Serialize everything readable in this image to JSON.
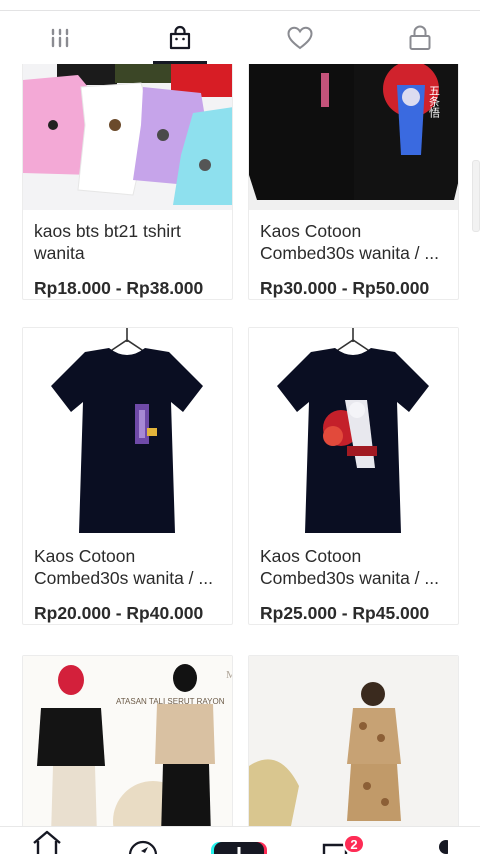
{
  "tabs": [
    {
      "icon": "grid-icon",
      "active": false
    },
    {
      "icon": "shopping-bag-icon",
      "active": true
    },
    {
      "icon": "heart-icon",
      "active": false
    },
    {
      "icon": "lock-icon",
      "active": false
    }
  ],
  "products": [
    {
      "title": "kaos bts bt21 tshirt wanita",
      "price": "Rp18.000 - Rp38.000",
      "image": "pastel-tshirts-photo"
    },
    {
      "title": "Kaos Cotoon Combed30s wanita / ...",
      "price": "Rp30.000 - Rp50.000",
      "image": "black-anime-tshirt-photo"
    },
    {
      "title": "Kaos Cotoon Combed30s wanita / ...",
      "price": "Rp20.000 - Rp40.000",
      "image": "black-tshirt-purple-print-photo"
    },
    {
      "title": "Kaos Cotoon Combed30s wanita / ...",
      "price": "Rp25.000 - Rp45.000",
      "image": "black-tshirt-red-print-photo"
    },
    {
      "title": "",
      "price": "",
      "image": "hijab-models-photo"
    },
    {
      "title": "",
      "price": "",
      "image": "kid-camo-set-photo"
    }
  ],
  "product_photo_text": {
    "banner": "ATASAN TALI SERUT RAYON",
    "tag": "M",
    "kanji": "五条悟"
  },
  "bottom_nav": {
    "items": [
      "home-icon",
      "discover-icon",
      "create-icon",
      "inbox-icon",
      "profile-icon"
    ],
    "inbox_badge": "2"
  },
  "colors": {
    "accent": "#fe2c55",
    "text": "#161823",
    "create_button_cyan": "#25f4ee"
  }
}
